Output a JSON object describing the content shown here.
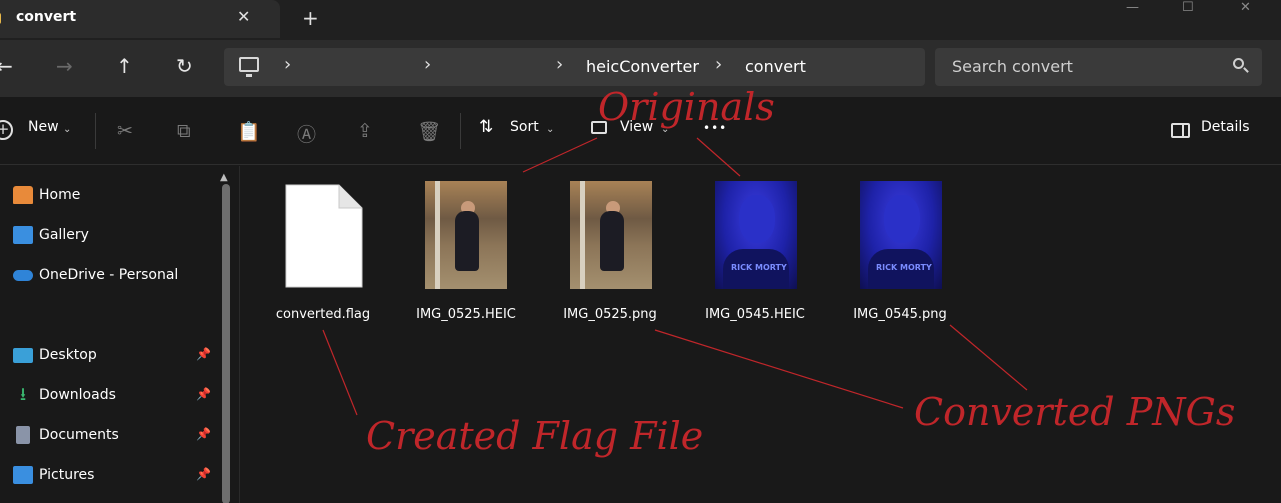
{
  "tab": {
    "title": "convert",
    "close": "✕",
    "new": "+"
  },
  "window_controls": {
    "minimize": "—",
    "maximize": "☐",
    "close": "✕"
  },
  "nav": {
    "back": "←",
    "forward": "→",
    "up": "↑",
    "refresh": "↻"
  },
  "address": {
    "chevrons": [
      "›",
      "›",
      "›",
      "›"
    ],
    "segments": [
      "heicConverter",
      "convert"
    ]
  },
  "search": {
    "placeholder": "Search convert"
  },
  "toolbar": {
    "new_label": "New",
    "sort_label": "Sort",
    "view_label": "View",
    "more": "•••",
    "details_label": "Details"
  },
  "sidebar": {
    "items": [
      {
        "label": "Home",
        "icon": "home-icon",
        "color": "#e88a3a"
      },
      {
        "label": "Gallery",
        "icon": "gallery-icon",
        "color": "#3a8fe0"
      },
      {
        "label": "OneDrive - Personal",
        "icon": "cloud-icon",
        "color": "#2f84d8"
      },
      {
        "label": "Desktop",
        "icon": "desktop-icon",
        "color": "#3aa0d8",
        "pinned": true
      },
      {
        "label": "Downloads",
        "icon": "download-icon",
        "color": "#3ab870",
        "pinned": true
      },
      {
        "label": "Documents",
        "icon": "documents-icon",
        "color": "#8a94a8",
        "pinned": true
      },
      {
        "label": "Pictures",
        "icon": "pictures-icon",
        "color": "#3a8fe0",
        "pinned": true
      }
    ]
  },
  "files": [
    {
      "name": "converted.flag",
      "kind": "document"
    },
    {
      "name": "IMG_0525.HEIC",
      "kind": "photo-warm"
    },
    {
      "name": "IMG_0525.png",
      "kind": "photo-warm"
    },
    {
      "name": "IMG_0545.HEIC",
      "kind": "photo-blue"
    },
    {
      "name": "IMG_0545.png",
      "kind": "photo-blue"
    }
  ],
  "annotations": {
    "originals": "Originals",
    "flag": "Created Flag File",
    "pngs": "Converted PNGs",
    "color": "#c0262a"
  }
}
